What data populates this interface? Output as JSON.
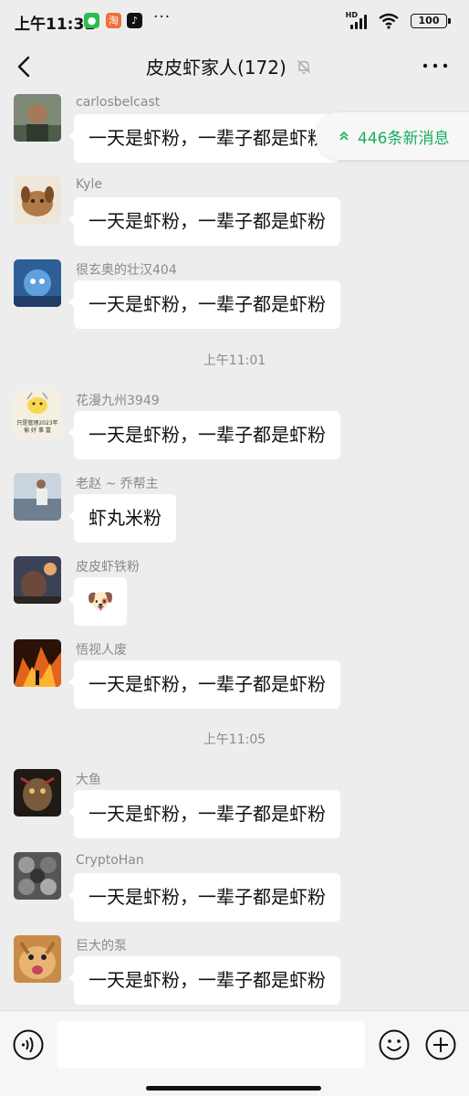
{
  "status_bar": {
    "time": "上午11:31",
    "dots": "···",
    "network": "HD",
    "battery": "100",
    "app_icons": [
      "wechat-icon",
      "taobao-icon",
      "tiktok-icon"
    ]
  },
  "header": {
    "title": "皮皮虾家人(172)",
    "back_icon": "chevron-left-icon",
    "mute_icon": "bell-off-icon",
    "more_icon": "more-dots-icon"
  },
  "new_messages_pill": {
    "label": "446条新消息",
    "icon": "double-chevron-up-icon",
    "color": "#1aad60"
  },
  "messages": [
    {
      "type": "message",
      "sender": "carlosbelcast",
      "text": "一天是虾粉，一辈子都是虾粉",
      "avatar_color": "#5b6b58"
    },
    {
      "type": "message",
      "sender": "Kyle",
      "text": "一天是虾粉，一辈子都是虾粉",
      "avatar_color": "#b88a5c"
    },
    {
      "type": "message",
      "sender": "很玄奥的壮汉404",
      "text": "一天是虾粉，一辈子都是虾粉",
      "avatar_color": "#3f79b8"
    },
    {
      "type": "time",
      "text": "上午11:01"
    },
    {
      "type": "message",
      "sender": "花漫九州3949",
      "text": "一天是虾粉，一辈子都是虾粉",
      "avatar_color": "#f3ecd8",
      "avatar_caption": "只是管理2023年 偷 好 事 富"
    },
    {
      "type": "message",
      "sender": "老赵 ~ 乔帮主",
      "text": "虾丸米粉",
      "avatar_color": "#9aa7b4"
    },
    {
      "type": "message",
      "sender": "皮皮虾铁粉",
      "text": "🐶",
      "avatar_color": "#6b5a55"
    },
    {
      "type": "message",
      "sender": "悟视人废",
      "text": "一天是虾粉，一辈子都是虾粉",
      "avatar_color": "#d26a1e"
    },
    {
      "type": "time",
      "text": "上午11:05"
    },
    {
      "type": "message",
      "sender": "大鱼",
      "text": "一天是虾粉，一辈子都是虾粉",
      "avatar_color": "#4a3d33"
    },
    {
      "type": "message",
      "sender": "CryptoHan",
      "text": "一天是虾粉，一辈子都是虾粉",
      "avatar_color": "#6d6d6d"
    },
    {
      "type": "message",
      "sender": "巨大的泵",
      "text": "一天是虾粉，一辈子都是虾粉",
      "avatar_color": "#d9a05a"
    }
  ],
  "input_bar": {
    "voice_icon": "voice-icon",
    "emoji_icon": "emoji-smile-icon",
    "plus_icon": "plus-circle-icon",
    "placeholder": ""
  }
}
